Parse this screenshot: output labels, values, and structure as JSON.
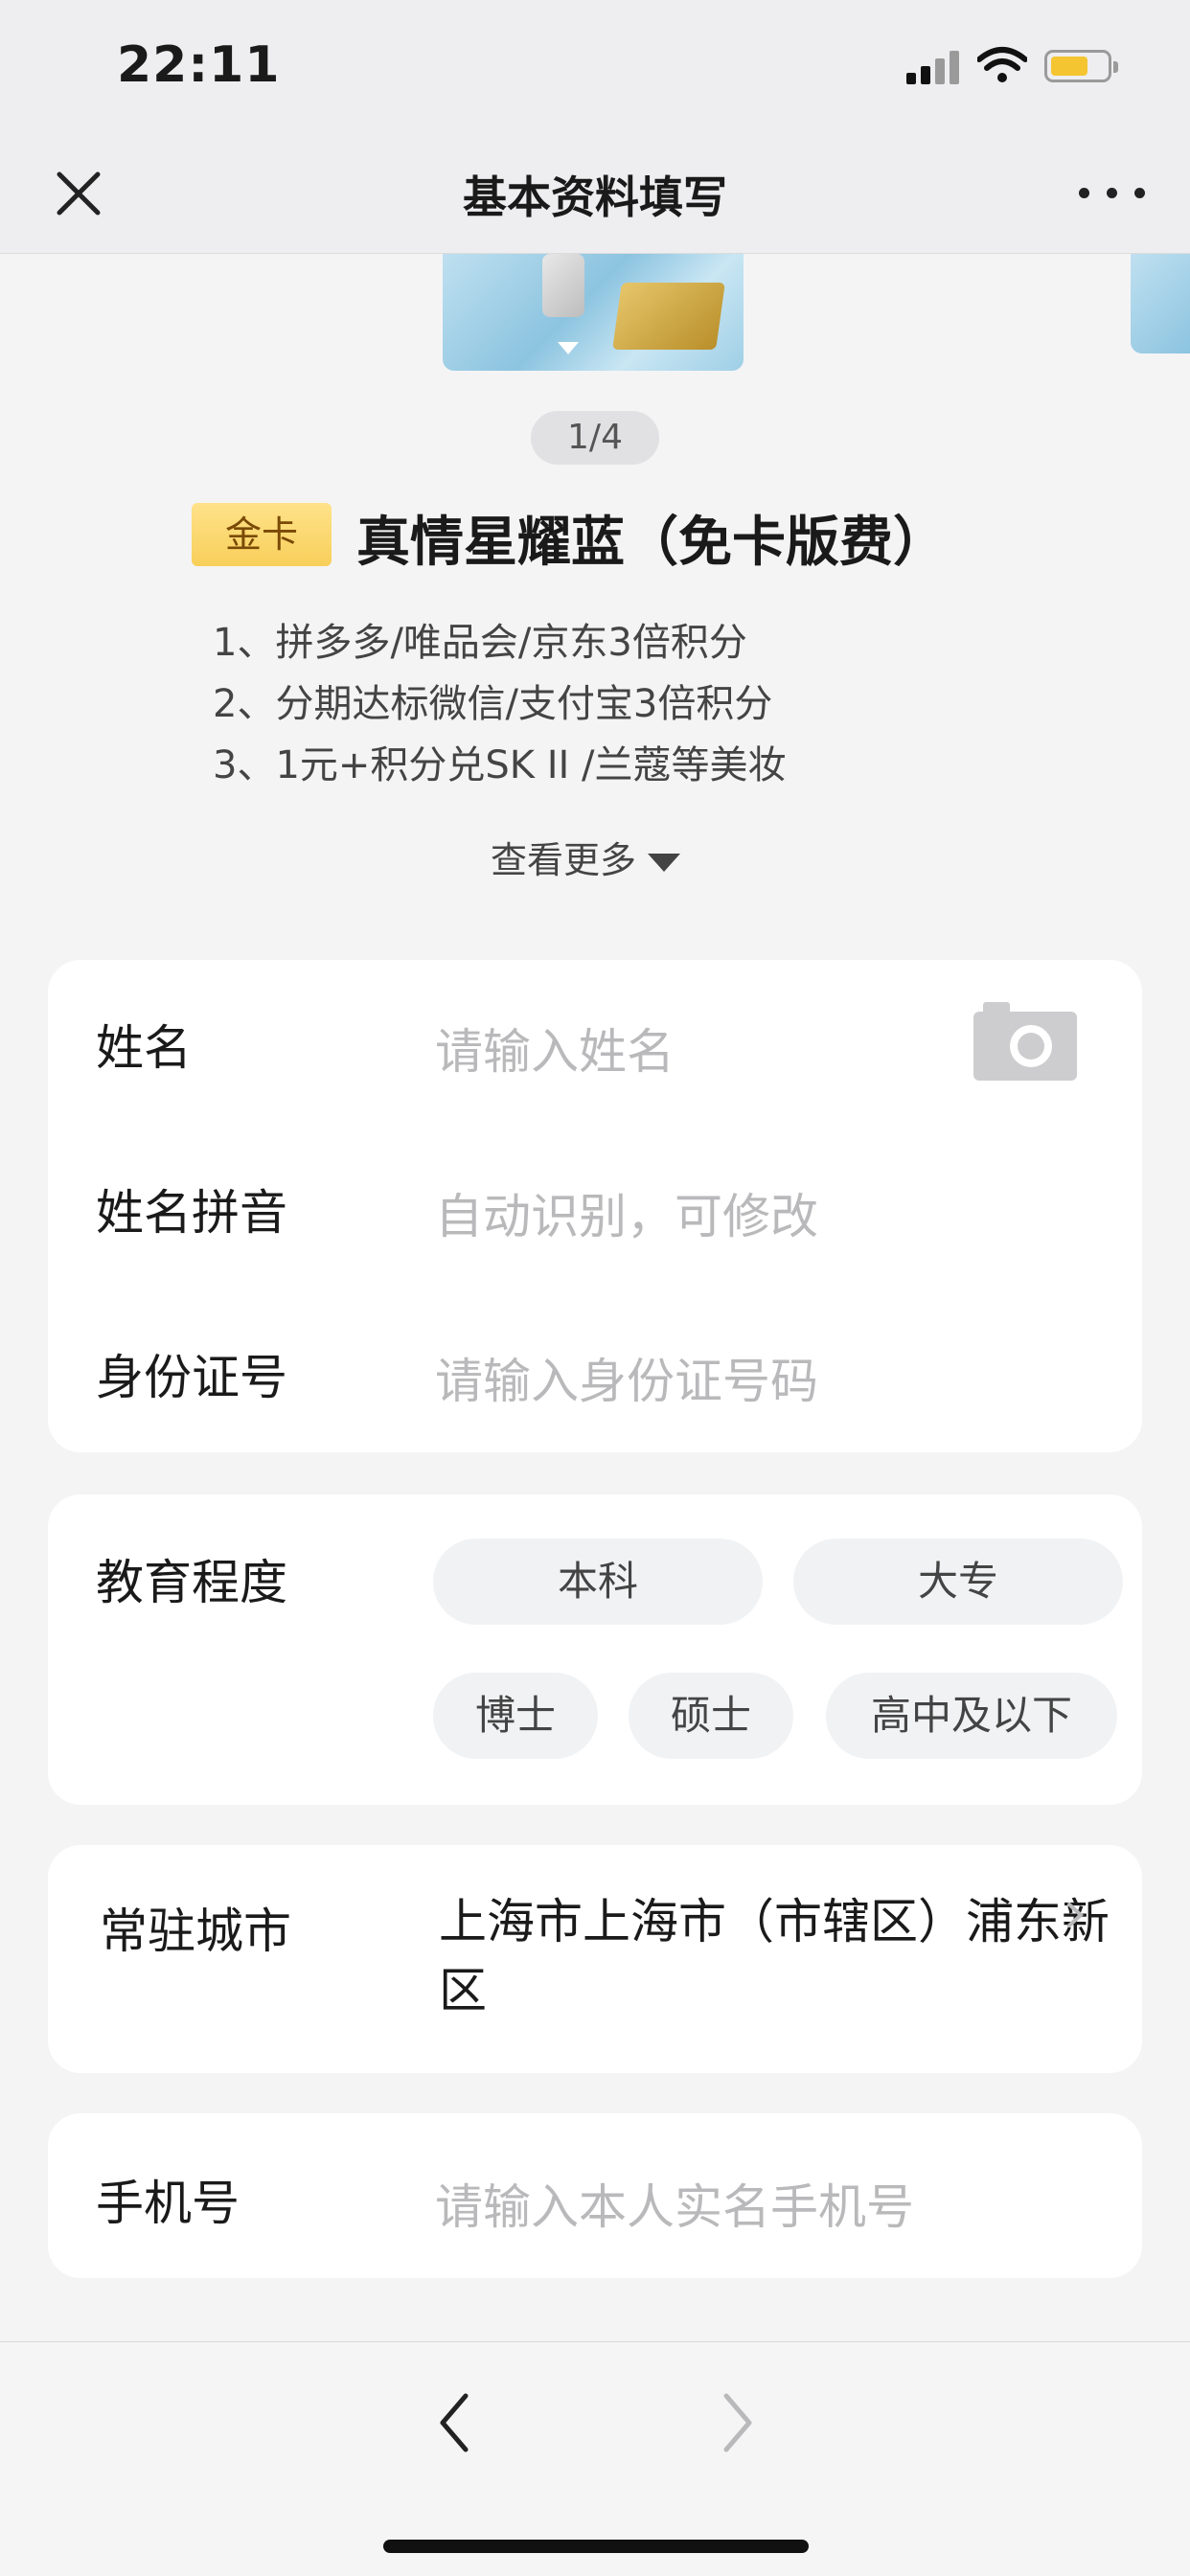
{
  "status_bar": {
    "time": "22:11"
  },
  "nav": {
    "title": "基本资料填写"
  },
  "card": {
    "pager": "1/4",
    "badge": "金卡",
    "name": "真情星耀蓝（免卡版费）",
    "features": [
      "1、拼多多/唯品会/京东3倍积分",
      "2、分期达标微信/支付宝3倍积分",
      "3、1元+积分兑SK II /兰蔻等美妆"
    ],
    "see_more": "查看更多"
  },
  "identity": {
    "name_label": "姓名",
    "name_placeholder": "请输入姓名",
    "pinyin_label": "姓名拼音",
    "pinyin_placeholder": "自动识别，可修改",
    "id_label": "身份证号",
    "id_placeholder": "请输入身份证号码"
  },
  "education": {
    "label": "教育程度",
    "options": [
      "本科",
      "大专",
      "博士",
      "硕士",
      "高中及以下"
    ]
  },
  "city": {
    "label": "常驻城市",
    "value": "上海市上海市（市辖区）浦东新区"
  },
  "phone": {
    "label": "手机号",
    "placeholder": "请输入本人实名手机号"
  },
  "colors": {
    "accent_gold": "#f7cf5a",
    "card_blue": "#8cc4e0"
  }
}
